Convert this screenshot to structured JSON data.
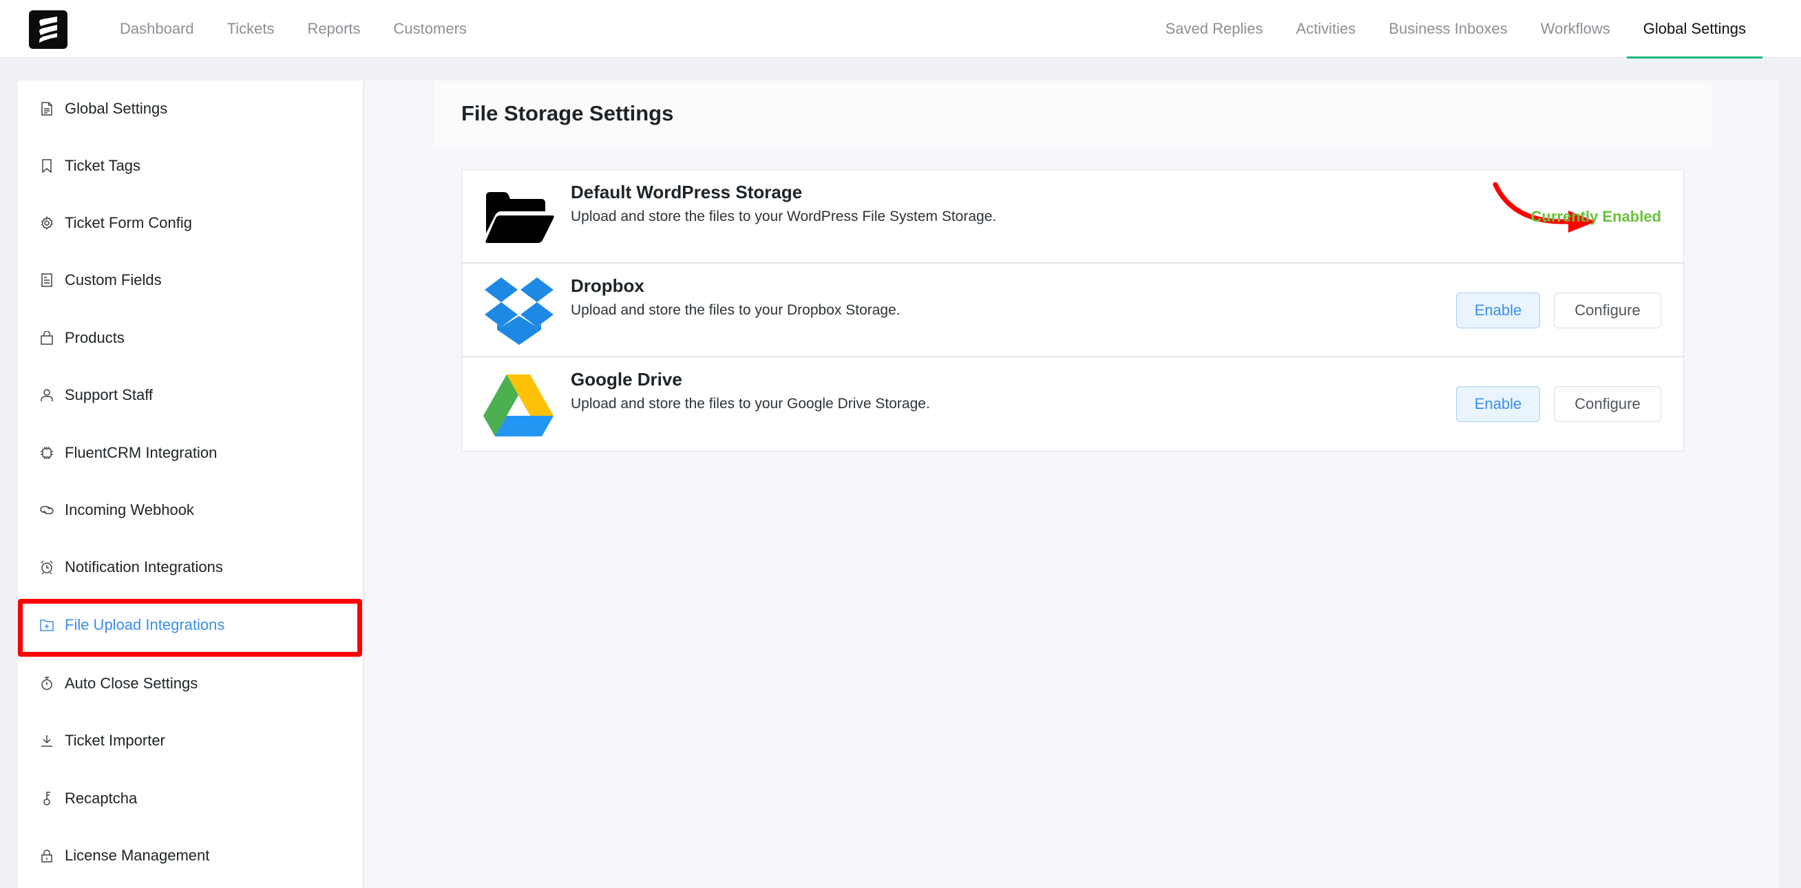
{
  "brand": {
    "logo_icon": "fluent-support-logo-icon"
  },
  "nav": {
    "left": [
      {
        "label": "Dashboard"
      },
      {
        "label": "Tickets"
      },
      {
        "label": "Reports"
      },
      {
        "label": "Customers"
      }
    ],
    "right": [
      {
        "label": "Saved Replies"
      },
      {
        "label": "Activities"
      },
      {
        "label": "Business Inboxes"
      },
      {
        "label": "Workflows"
      },
      {
        "label": "Global Settings",
        "active": true
      }
    ]
  },
  "sidebar": {
    "items": [
      {
        "label": "Global Settings",
        "icon": "document-icon"
      },
      {
        "label": "Ticket Tags",
        "icon": "bookmark-icon"
      },
      {
        "label": "Ticket Form Config",
        "icon": "gear-icon"
      },
      {
        "label": "Custom Fields",
        "icon": "form-icon"
      },
      {
        "label": "Products",
        "icon": "shopping-bag-icon"
      },
      {
        "label": "Support Staff",
        "icon": "user-icon"
      },
      {
        "label": "FluentCRM Integration",
        "icon": "chip-icon"
      },
      {
        "label": "Incoming Webhook",
        "icon": "link-icon"
      },
      {
        "label": "Notification Integrations",
        "icon": "alarm-clock-icon"
      },
      {
        "label": "File Upload Integrations",
        "icon": "folder-add-icon",
        "active": true
      },
      {
        "label": "Auto Close Settings",
        "icon": "stopwatch-icon"
      },
      {
        "label": "Ticket Importer",
        "icon": "download-icon"
      },
      {
        "label": "Recaptcha",
        "icon": "key-icon"
      },
      {
        "label": "License Management",
        "icon": "lock-icon"
      }
    ]
  },
  "main": {
    "title": "File Storage Settings",
    "providers": [
      {
        "title": "Default WordPress Storage",
        "description": "Upload and store the files to your WordPress File System Storage.",
        "icon": "folder-open-icon",
        "status": "Currently Enabled"
      },
      {
        "title": "Dropbox",
        "description": "Upload and store the files to your Dropbox Storage.",
        "icon": "dropbox-icon",
        "enable_label": "Enable",
        "configure_label": "Configure"
      },
      {
        "title": "Google Drive",
        "description": "Upload and store the files to your Google Drive Storage.",
        "icon": "google-drive-icon",
        "enable_label": "Enable",
        "configure_label": "Configure"
      }
    ]
  },
  "colors": {
    "accent_green": "#1fb77a",
    "active_blue": "#3a8fe8",
    "enabled_green": "#67c23a",
    "annotation_red": "#ff0000"
  }
}
